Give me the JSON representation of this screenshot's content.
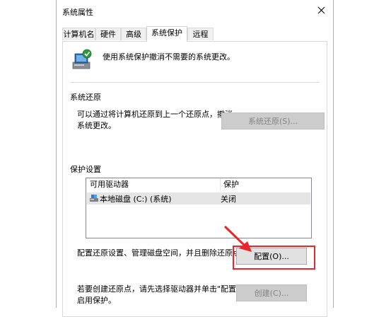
{
  "window": {
    "title": "系统属性"
  },
  "tabs": [
    {
      "label": "计算机名",
      "active": false
    },
    {
      "label": "硬件",
      "active": false
    },
    {
      "label": "高级",
      "active": false
    },
    {
      "label": "系统保护",
      "active": true
    },
    {
      "label": "远程",
      "active": false
    }
  ],
  "intro": {
    "text": "使用系统保护撤消不需要的系统更改。"
  },
  "restore": {
    "group_title": "系统还原",
    "description_line1": "可以通过将计算机还原到上一个还原点，撤消",
    "description_line2": "系统更改。",
    "button_label": "系统还原(S)..."
  },
  "protection": {
    "group_title": "保护设置",
    "columns": [
      "可用驱动器",
      "保护"
    ],
    "drives": [
      {
        "name": "本地磁盘 (C:) (系统)",
        "status": "关闭"
      }
    ],
    "configure_text": "配置还原设置、管理磁盘空间，并且删除还原点。",
    "configure_button": "配置(O)...",
    "create_text_line1": "若要创建还原点，请先选择驱动器并单击\"配置\"来",
    "create_text_line2": "启用保护。",
    "create_button": "创建(C)..."
  },
  "colors": {
    "highlight": "#e8262b",
    "selected_row": "#e5e5e5",
    "disabled_button": "#cccccc"
  },
  "icons": [
    "close-icon",
    "system-protection-icon",
    "drive-icon",
    "arrow-annotation-icon"
  ]
}
